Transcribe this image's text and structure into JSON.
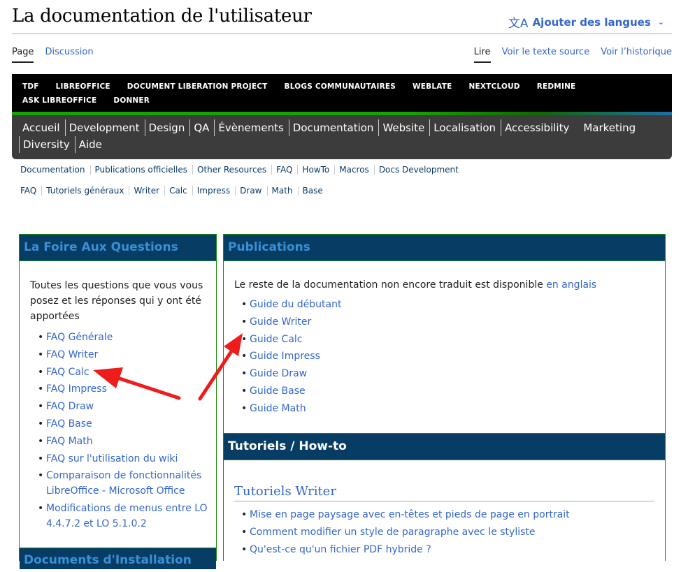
{
  "page": {
    "title": "La documentation de l'utilisateur",
    "lang_button": {
      "icon": "translate-icon",
      "label": "Ajouter des langues"
    }
  },
  "tabs_left": [
    "Page",
    "Discussion"
  ],
  "tabs_right": [
    "Lire",
    "Voir le texte source",
    "Voir l’historique"
  ],
  "tdf_menu": [
    "TDF",
    "LIBREOFFICE",
    "DOCUMENT LIBERATION PROJECT",
    "BLOGS COMMUNAUTAIRES",
    "WEBLATE",
    "NEXTCLOUD",
    "REDMINE",
    "ASK LIBREOFFICE",
    "DONNER"
  ],
  "main_menu": [
    "Accueil",
    "Development",
    "Design",
    "QA",
    "Évènements",
    "Documentation",
    "Website",
    "Localisation",
    "Accessibility",
    "Marketing",
    "Diversity",
    "Aide"
  ],
  "subnav1": [
    "Documentation",
    "Publications officielles",
    "Other Resources",
    "FAQ",
    "HowTo",
    "Macros",
    "Docs Development"
  ],
  "subnav2": [
    "FAQ",
    "Tutoriels généraux",
    "Writer",
    "Calc",
    "Impress",
    "Draw",
    "Math",
    "Base"
  ],
  "faq_box": {
    "title": "La Foire Aux Questions",
    "intro": "Toutes les questions que vous vous posez et les réponses qui y ont été apportées",
    "links": [
      "FAQ Générale",
      "FAQ Writer",
      "FAQ Calc",
      "FAQ Impress",
      "FAQ Draw",
      "FAQ Base",
      "FAQ Math",
      "FAQ sur l'utilisation du wiki",
      "Comparaison de fonctionnalités LibreOffice - Microsoft Office",
      "Modifications de menus entre LO 4.4.7.2 et LO 5.1.0.2"
    ]
  },
  "install_box": {
    "title": "Documents d'Installation"
  },
  "pub_box": {
    "title": "Publications",
    "intro": "Le reste de la documentation non encore traduit est disponible",
    "intro_link": "en anglais",
    "links": [
      "Guide du débutant",
      "Guide Writer",
      "Guide Calc",
      "Guide Impress",
      "Guide Draw",
      "Guide Base",
      "Guide Math"
    ]
  },
  "tut_box": {
    "title": "Tutoriels / How-to",
    "subheading": "Tutoriels Writer",
    "links": [
      "Mise en page paysage avec en-têtes et pieds de page en portrait",
      "Comment modifier un style de paragraphe avec le styliste",
      "Qu'est-ce qu'un fichier PDF hybride ?"
    ]
  },
  "annotations": {
    "arrow_color": "#ee1c1c"
  },
  "colors": {
    "link": "#3366cc",
    "box_header": "#073d64",
    "box_border": "#1d8a0c"
  }
}
